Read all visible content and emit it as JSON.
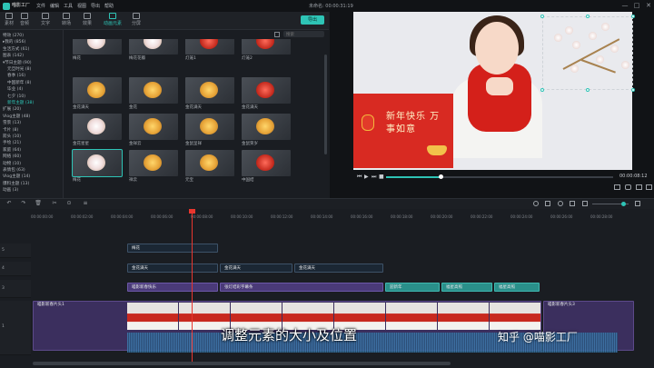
{
  "app": {
    "logo_text": "喵影工厂",
    "menus": [
      "文件",
      "编辑",
      "工具",
      "视图",
      "导出",
      "帮助"
    ],
    "project_title": "未命名: 00:00:31:19",
    "window_buttons": [
      "—",
      "□",
      "✕"
    ]
  },
  "toolbar": {
    "tabs": [
      {
        "label": "素材",
        "icon": "media-icon"
      },
      {
        "label": "音频",
        "icon": "music-icon"
      },
      {
        "label": "文字",
        "icon": "text-icon"
      },
      {
        "label": "转场",
        "icon": "transition-icon"
      },
      {
        "label": "效果",
        "icon": "effects-icon"
      },
      {
        "label": "动画元素",
        "icon": "elements-icon",
        "active": true
      },
      {
        "label": "分屏",
        "icon": "splitscreen-icon"
      }
    ],
    "export_label": "导出"
  },
  "sidebar": {
    "items": [
      {
        "label": "特效 (270)"
      },
      {
        "label": "▸我的 (856)"
      },
      {
        "label": "生活方式 (61)"
      },
      {
        "label": "图表 (142)"
      },
      {
        "label": "▾节日主题 (90)"
      },
      {
        "label": "元旦时光 (8)",
        "indent": true
      },
      {
        "label": "春季 (16)",
        "indent": true
      },
      {
        "label": "中国新年 (8)",
        "indent": true
      },
      {
        "label": "毕业 (4)",
        "indent": true
      },
      {
        "label": "七夕 (10)",
        "indent": true
      },
      {
        "label": "新年主题 (38)",
        "indent": true,
        "selected": true
      },
      {
        "label": "扩展 (20)"
      },
      {
        "label": "Vlog主题 (48)"
      },
      {
        "label": "雪景 (13)"
      },
      {
        "label": "卡片 (8)"
      },
      {
        "label": "箭头 (10)"
      },
      {
        "label": "手绘 (21)"
      },
      {
        "label": "家庭 (64)"
      },
      {
        "label": "网络 (60)"
      },
      {
        "label": "动物 (10)"
      },
      {
        "label": "表情包 (63)"
      },
      {
        "label": "Vlog主题 (14)"
      },
      {
        "label": "爆料主题 (13)"
      },
      {
        "label": "动画 (3)"
      }
    ]
  },
  "library": {
    "search_placeholder": "搜索",
    "items": [
      {
        "label": "梅花",
        "tone": "white"
      },
      {
        "label": "梅花花瓣",
        "tone": "white"
      },
      {
        "label": "灯笼1",
        "tone": "red"
      },
      {
        "label": "灯笼2",
        "tone": "red"
      },
      {
        "label": "金花满天",
        "tone": "gold"
      },
      {
        "label": "金花",
        "tone": "gold"
      },
      {
        "label": "金花满天",
        "tone": "gold"
      },
      {
        "label": "金花满天",
        "tone": "red"
      },
      {
        "label": "金花星星",
        "tone": "white"
      },
      {
        "label": "金祥云",
        "tone": "gold"
      },
      {
        "label": "金鼠呈祥",
        "tone": "gold"
      },
      {
        "label": "金鼠贺岁",
        "tone": "gold"
      },
      {
        "label": "梅花",
        "tone": "white",
        "selected": true
      },
      {
        "label": "祥云",
        "tone": "gold"
      },
      {
        "label": "元宝",
        "tone": "gold"
      },
      {
        "label": "中国结",
        "tone": "red"
      }
    ]
  },
  "preview": {
    "banner_text": "新年快乐 万事如意",
    "timecode": "00:00:08:12",
    "controls": [
      "⏮",
      "▶",
      "⏭",
      "■"
    ],
    "progress": 0.24
  },
  "timeline": {
    "tools": [
      "↶",
      "↷",
      "🗑",
      "✂",
      "⊙",
      "≡"
    ],
    "ruler": [
      "00:00:00:00",
      "00:00:02:00",
      "00:00:04:00",
      "00:00:06:00",
      "00:00:08:00",
      "00:00:10:00",
      "00:00:12:00",
      "00:00:14:00",
      "00:00:16:00",
      "00:00:18:00",
      "00:00:20:00",
      "00:00:22:00",
      "00:00:24:00",
      "00:00:26:00",
      "00:00:28:00"
    ],
    "tracks": [
      {
        "name": "5"
      },
      {
        "name": "4"
      },
      {
        "name": "3"
      },
      {
        "name": "2"
      },
      {
        "name": "1"
      }
    ],
    "clips": {
      "track5": [
        {
          "label": "梅花"
        }
      ],
      "track4": [
        {
          "label": "金花满天"
        },
        {
          "label": "金花满天"
        },
        {
          "label": "金花满天"
        }
      ],
      "track3": [
        {
          "label": "喵影新春快乐"
        },
        {
          "label": "张灯结彩字幕条"
        },
        {
          "label": "迎新年"
        },
        {
          "label": "福星高照"
        },
        {
          "label": "福星高照"
        },
        {
          "label": "福星高照"
        }
      ],
      "track1": [
        {
          "label": "喵影新春片头1"
        },
        {
          "label": "喵影新春片头3"
        }
      ]
    },
    "subtitle": "调整元素的大小及位置",
    "watermark": "知乎 @喵影工厂"
  }
}
